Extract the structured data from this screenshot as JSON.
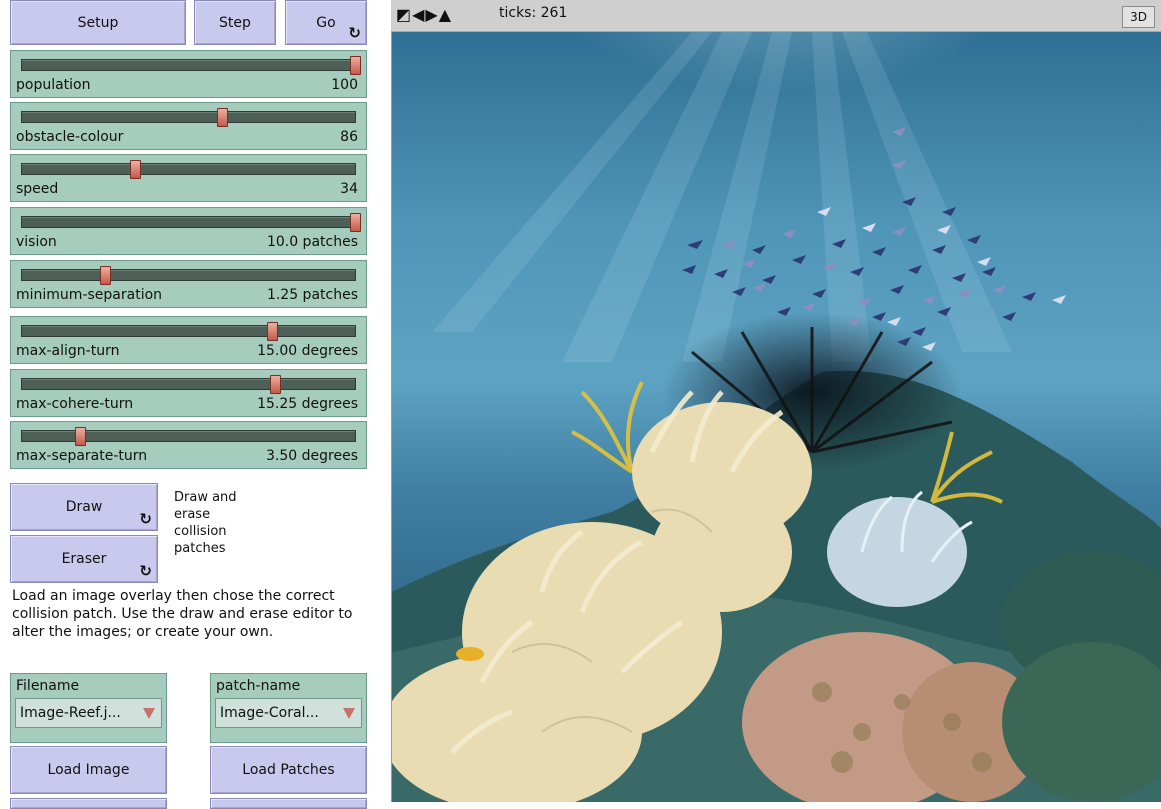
{
  "buttons": {
    "setup": "Setup",
    "step": "Step",
    "go": "Go",
    "draw": "Draw",
    "eraser": "Eraser",
    "load_image": "Load Image",
    "load_patches": "Load Patches",
    "forever_icon": "cycle-arrows-icon"
  },
  "sliders": [
    {
      "name": "population",
      "value": "100",
      "fraction": 1.0
    },
    {
      "name": "obstacle-colour",
      "value": "86",
      "fraction": 0.6
    },
    {
      "name": "speed",
      "value": "34",
      "fraction": 0.34
    },
    {
      "name": "vision",
      "value": "10.0 patches",
      "fraction": 1.0
    },
    {
      "name": "minimum-separation",
      "value": "1.25 patches",
      "fraction": 0.25
    },
    {
      "name": "max-align-turn",
      "value": "15.00 degrees",
      "fraction": 0.75
    },
    {
      "name": "max-cohere-turn",
      "value": "15.25 degrees",
      "fraction": 0.76
    },
    {
      "name": "max-separate-turn",
      "value": "3.50 degrees",
      "fraction": 0.175
    }
  ],
  "notes": {
    "draw_erase": "Draw and erase collision patches",
    "instructions": "Load an image overlay then chose the correct collision patch.  Use the draw and erase editor to alter the images; or create your own."
  },
  "choosers": {
    "filename": {
      "label": "Filename",
      "value": "Image-Reef.j..."
    },
    "patch_name": {
      "label": "patch-name",
      "value": "Image-Coral..."
    }
  },
  "view": {
    "ticks": "ticks: 261",
    "button_3d": "3D"
  },
  "colors": {
    "button": "#c9c9ee",
    "widget": "#a6ccbe",
    "knob": "#c55a4a"
  }
}
